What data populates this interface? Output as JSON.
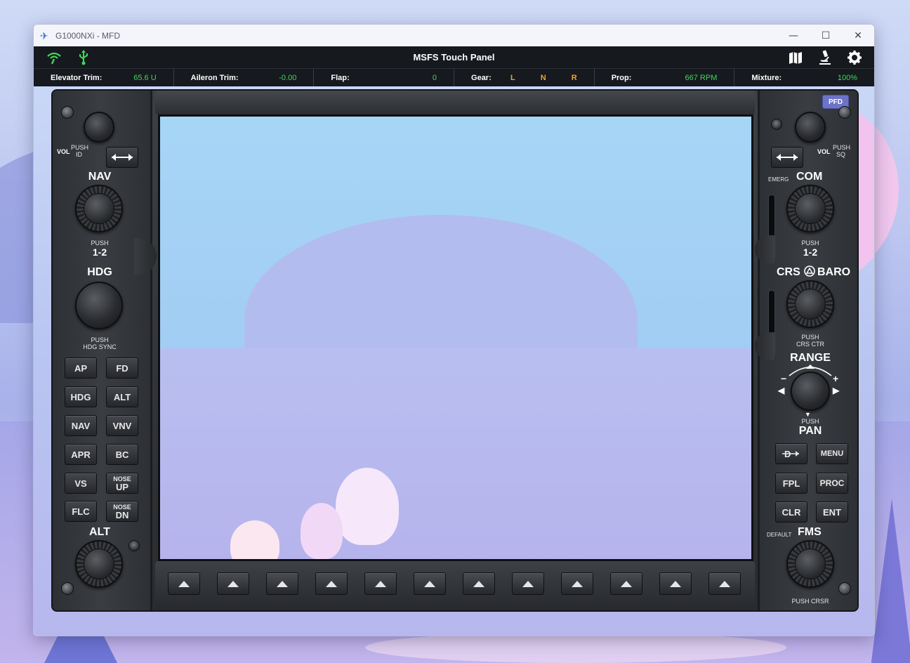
{
  "window": {
    "title": "G1000NXi - MFD",
    "controls": {
      "minimize": "—",
      "maximize": "☐",
      "close": "✕"
    }
  },
  "appbar": {
    "title": "MSFS Touch Panel",
    "left_icons": [
      "signal-icon",
      "usb-icon"
    ],
    "right_icons": [
      "map-icon",
      "microscope-icon",
      "gear-icon"
    ],
    "accent_color": "#42d75b"
  },
  "databar": {
    "elevator_trim": {
      "label": "Elevator Trim:",
      "value": "65.6 U"
    },
    "aileron_trim": {
      "label": "Aileron Trim:",
      "value": "-0.00"
    },
    "flap": {
      "label": "Flap:",
      "value": "0"
    },
    "gear": {
      "label": "Gear:",
      "left": "L",
      "nose": "N",
      "right": "R"
    },
    "prop": {
      "label": "Prop:",
      "value": "667 RPM"
    },
    "mixture": {
      "label": "Mixture:",
      "value": "100%"
    }
  },
  "left_panel": {
    "vol_label": "VOL",
    "push_id": [
      "PUSH",
      "ID"
    ],
    "nav": {
      "title": "NAV",
      "push": "PUSH",
      "sub": "1-2"
    },
    "hdg": {
      "title": "HDG",
      "push": "PUSH",
      "sub": "HDG SYNC"
    },
    "buttons": [
      [
        "AP",
        "FD"
      ],
      [
        "HDG",
        "ALT"
      ],
      [
        "NAV",
        "VNV"
      ],
      [
        "APR",
        "BC"
      ],
      [
        "VS"
      ],
      [
        "FLC"
      ]
    ],
    "nose_up": {
      "top": "NOSE",
      "bottom": "UP"
    },
    "nose_dn": {
      "top": "NOSE",
      "bottom": "DN"
    },
    "alt": {
      "title": "ALT"
    }
  },
  "right_panel": {
    "pfd_button": "PFD",
    "vol_label": "VOL",
    "push_sq": [
      "PUSH",
      "SQ"
    ],
    "emerg": "EMERG",
    "com": {
      "title": "COM",
      "push": "PUSH",
      "sub": "1-2"
    },
    "crs_baro": {
      "crs": "CRS",
      "baro": "BARO",
      "push": "PUSH",
      "sub": "CRS CTR"
    },
    "range": {
      "title": "RANGE",
      "minus": "−",
      "plus": "+"
    },
    "pan": {
      "push": "PUSH",
      "title": "PAN"
    },
    "buttons": {
      "direct_to_icon": "direct-to-icon",
      "menu": "MENU",
      "fpl": "FPL",
      "proc": "PROC",
      "clr": "CLR",
      "ent": "ENT"
    },
    "default_label": "DEFAULT",
    "fms": {
      "title": "FMS",
      "push": "PUSH CRSR"
    }
  },
  "softkeys": {
    "count": 12,
    "icon": "up-triangle-icon"
  }
}
